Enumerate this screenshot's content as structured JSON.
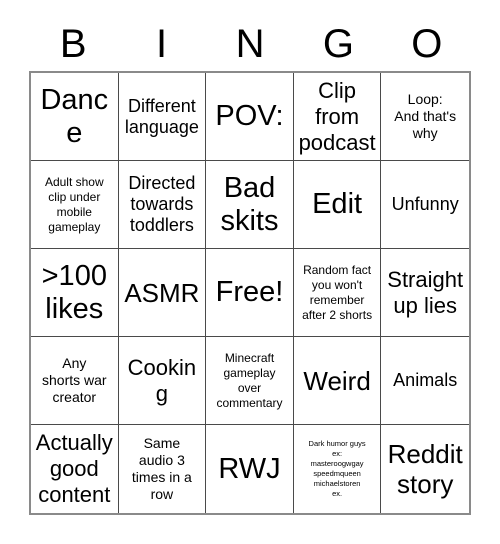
{
  "card": {
    "title": "BINGO",
    "header_letters": [
      "B",
      "I",
      "N",
      "G",
      "O"
    ],
    "grid_size": "5x5",
    "free_space": "Free!",
    "colors": {
      "background": "#ffffff",
      "text": "#000000",
      "cell_border": "#4a4a4a",
      "outer_border": "#8a8a8a"
    },
    "rows": [
      [
        {
          "text": "Dance",
          "size": "xxl"
        },
        {
          "text": "Different\nlanguage",
          "size": "md"
        },
        {
          "text": "POV:",
          "size": "xxl"
        },
        {
          "text": "Clip\nfrom\npodcast",
          "size": "lg"
        },
        {
          "text": "Loop:\nAnd that's\nwhy",
          "size": "sm"
        }
      ],
      [
        {
          "text": "Adult show\nclip under\nmobile\ngameplay",
          "size": "xs"
        },
        {
          "text": "Directed\ntowards\ntoddlers",
          "size": "md"
        },
        {
          "text": "Bad\nskits",
          "size": "xxl"
        },
        {
          "text": "Edit",
          "size": "xxl"
        },
        {
          "text": "Unfunny",
          "size": "md"
        }
      ],
      [
        {
          "text": ">100\nlikes",
          "size": "xxl"
        },
        {
          "text": "ASMR",
          "size": "xl"
        },
        {
          "text": "Free!",
          "size": "xxl"
        },
        {
          "text": "Random fact\nyou won't\nremember\nafter 2 shorts",
          "size": "xs"
        },
        {
          "text": "Straight\nup lies",
          "size": "lg"
        }
      ],
      [
        {
          "text": "Any\nshorts war\ncreator",
          "size": "sm"
        },
        {
          "text": "Cooking",
          "size": "lg"
        },
        {
          "text": "Minecraft\ngameplay\nover\ncommentary",
          "size": "xs"
        },
        {
          "text": "Weird",
          "size": "xl"
        },
        {
          "text": "Animals",
          "size": "md"
        }
      ],
      [
        {
          "text": "Actually\ngood\ncontent",
          "size": "lg"
        },
        {
          "text": "Same\naudio 3\ntimes in a\nrow",
          "size": "sm"
        },
        {
          "text": "RWJ",
          "size": "xxl"
        },
        {
          "text": "Dark humor guys\nex:\nmasteroogwgay\nspeedmqueen\nmichaelstoren\nex.",
          "size": "xxs"
        },
        {
          "text": "Reddit\nstory",
          "size": "xl"
        }
      ]
    ]
  }
}
